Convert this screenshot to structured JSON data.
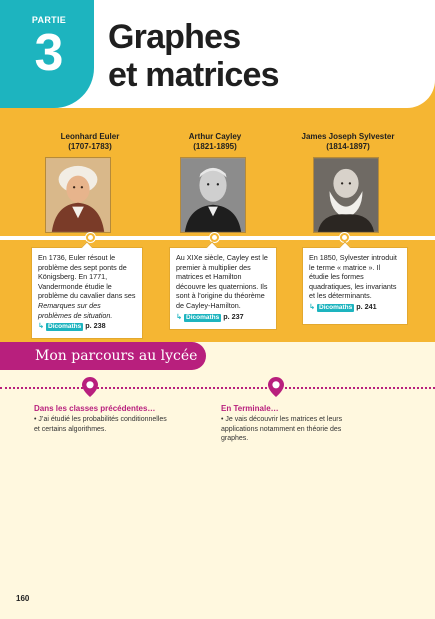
{
  "header": {
    "partie_label": "PARTIE",
    "partie_number": "3",
    "title_line1": "Graphes",
    "title_line2": "et matrices"
  },
  "timeline": [
    {
      "name": "Leonhard Euler",
      "dates": "(1707-1783)",
      "text": "En 1736, Euler résout le problème des sept ponts de Königsberg. En 1771, Vandermonde étudie le problème du cavalier dans ses",
      "text_italic": "Remarques sur des problèmes de situation.",
      "dico_label": "Dicomaths",
      "page_ref": "p. 238"
    },
    {
      "name": "Arthur Cayley",
      "dates": "(1821-1895)",
      "text": "Au XIXe siècle, Cayley est le premier à multiplier des matrices et Hamilton découvre les quaternions. Ils sont à l’origine du théorème de Cayley-Hamilton.",
      "text_italic": "",
      "dico_label": "Dicomaths",
      "page_ref": "p. 237"
    },
    {
      "name": "James Joseph Sylvester",
      "dates": "(1814-1897)",
      "text": "En 1850, Sylvester introduit le terme « matrice ». Il étudie les formes quadratiques, les invariants et les déterminants.",
      "text_italic": "",
      "dico_label": "Dicomaths",
      "page_ref": "p. 241"
    }
  ],
  "parcours": {
    "title": "Mon parcours au lycée",
    "left_heading": "Dans les classes précédentes…",
    "left_text": "• J’ai étudié les probabilités conditionnelles et certains algorithmes.",
    "right_heading": "En Terminale…",
    "right_text": "• Je vais découvrir les matrices et leurs applications notamment en théorie des graphes."
  },
  "page_number": "160",
  "colors": {
    "accent_teal": "#1db4bf",
    "accent_yellow": "#f5b633",
    "accent_magenta": "#b81f7d"
  }
}
